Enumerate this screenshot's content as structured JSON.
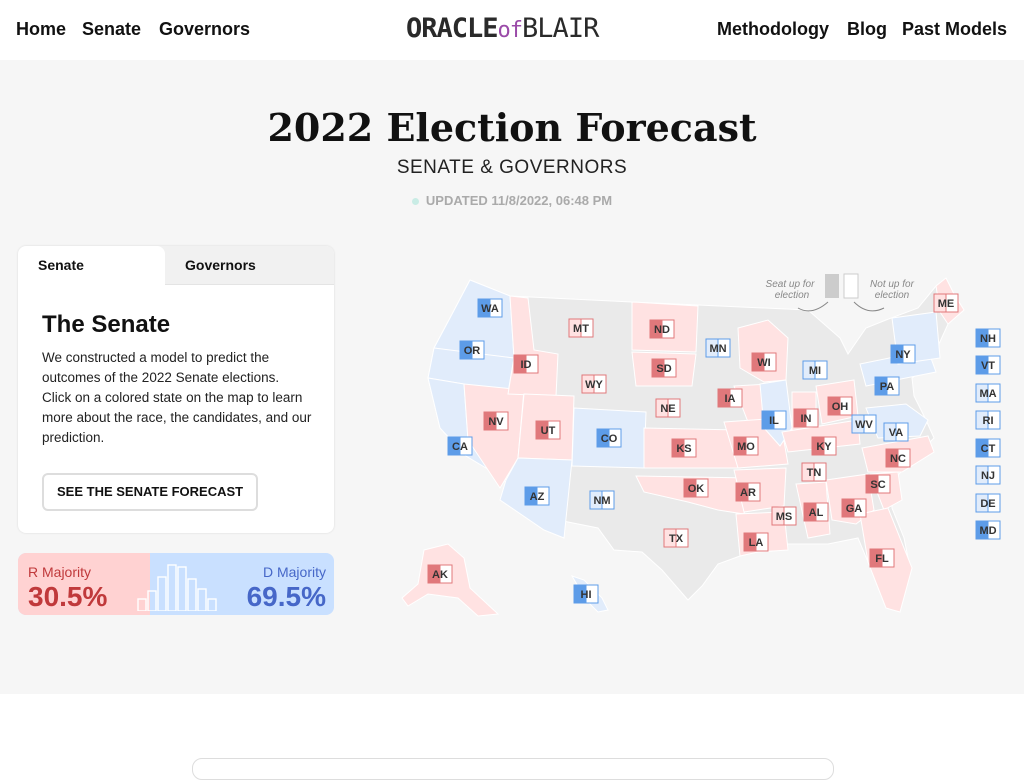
{
  "nav": {
    "left_links": [
      "Home",
      "Senate",
      "Governors"
    ],
    "right_links": [
      "Methodology",
      "Blog",
      "Past Models"
    ],
    "logo": {
      "part1": "ORACLE",
      "part2": "of",
      "part3": "BLAIR"
    }
  },
  "hero": {
    "title": "2022 Election Forecast",
    "subtitle": "SENATE & GOVERNORS",
    "updated": "UPDATED 11/8/2022, 06:48 PM"
  },
  "card": {
    "tabs": [
      "Senate",
      "Governors"
    ],
    "active_tab": "Senate",
    "heading": "The Senate",
    "description": "We constructed a model to predict the outcomes of the 2022 Senate elections. Click on a colored state on the map to learn more about the race, the candidates, and our prediction.",
    "cta_label": "SEE THE SENATE FORECAST"
  },
  "odds": {
    "r_label": "R Majority",
    "r_value": "30.5%",
    "d_label": "D Majority",
    "d_value": "69.5%",
    "r_fraction": 0.305
  },
  "map": {
    "legend": {
      "up": "Seat up for election",
      "not_up": "Not up for election"
    },
    "states": [
      {
        "abbr": "WA",
        "lean": "D",
        "senate": true
      },
      {
        "abbr": "OR",
        "lean": "D",
        "senate": true
      },
      {
        "abbr": "CA",
        "lean": "D",
        "senate": true
      },
      {
        "abbr": "NV",
        "lean": "R",
        "senate": true
      },
      {
        "abbr": "ID",
        "lean": "R",
        "senate": true
      },
      {
        "abbr": "MT",
        "lean": "R",
        "senate": false
      },
      {
        "abbr": "WY",
        "lean": "R",
        "senate": false
      },
      {
        "abbr": "UT",
        "lean": "R",
        "senate": true
      },
      {
        "abbr": "AZ",
        "lean": "D",
        "senate": true
      },
      {
        "abbr": "CO",
        "lean": "D",
        "senate": true
      },
      {
        "abbr": "NM",
        "lean": "D",
        "senate": false
      },
      {
        "abbr": "ND",
        "lean": "R",
        "senate": true
      },
      {
        "abbr": "SD",
        "lean": "R",
        "senate": true
      },
      {
        "abbr": "NE",
        "lean": "R",
        "senate": false
      },
      {
        "abbr": "KS",
        "lean": "R",
        "senate": true
      },
      {
        "abbr": "OK",
        "lean": "R",
        "senate": true
      },
      {
        "abbr": "TX",
        "lean": "R",
        "senate": false
      },
      {
        "abbr": "MN",
        "lean": "D",
        "senate": false
      },
      {
        "abbr": "IA",
        "lean": "R",
        "senate": true
      },
      {
        "abbr": "MO",
        "lean": "R",
        "senate": true
      },
      {
        "abbr": "AR",
        "lean": "R",
        "senate": true
      },
      {
        "abbr": "LA",
        "lean": "R",
        "senate": true
      },
      {
        "abbr": "WI",
        "lean": "R",
        "senate": true
      },
      {
        "abbr": "IL",
        "lean": "D",
        "senate": true
      },
      {
        "abbr": "MI",
        "lean": "D",
        "senate": false
      },
      {
        "abbr": "IN",
        "lean": "R",
        "senate": true
      },
      {
        "abbr": "OH",
        "lean": "R",
        "senate": true
      },
      {
        "abbr": "KY",
        "lean": "R",
        "senate": true
      },
      {
        "abbr": "TN",
        "lean": "R",
        "senate": false
      },
      {
        "abbr": "MS",
        "lean": "R",
        "senate": false
      },
      {
        "abbr": "AL",
        "lean": "R",
        "senate": true
      },
      {
        "abbr": "GA",
        "lean": "R",
        "senate": true
      },
      {
        "abbr": "FL",
        "lean": "R",
        "senate": true
      },
      {
        "abbr": "SC",
        "lean": "R",
        "senate": true
      },
      {
        "abbr": "NC",
        "lean": "R",
        "senate": true
      },
      {
        "abbr": "VA",
        "lean": "D",
        "senate": false
      },
      {
        "abbr": "WV",
        "lean": "D",
        "senate": false
      },
      {
        "abbr": "PA",
        "lean": "D",
        "senate": true
      },
      {
        "abbr": "NY",
        "lean": "D",
        "senate": true
      },
      {
        "abbr": "ME",
        "lean": "R",
        "senate": false
      },
      {
        "abbr": "AK",
        "lean": "R",
        "senate": true
      },
      {
        "abbr": "HI",
        "lean": "D",
        "senate": true
      },
      {
        "abbr": "NH",
        "lean": "D",
        "senate": true
      },
      {
        "abbr": "VT",
        "lean": "D",
        "senate": true
      },
      {
        "abbr": "MA",
        "lean": "D",
        "senate": false
      },
      {
        "abbr": "RI",
        "lean": "D",
        "senate": false
      },
      {
        "abbr": "CT",
        "lean": "D",
        "senate": true
      },
      {
        "abbr": "NJ",
        "lean": "D",
        "senate": false
      },
      {
        "abbr": "DE",
        "lean": "D",
        "senate": false
      },
      {
        "abbr": "MD",
        "lean": "D",
        "senate": true
      }
    ]
  },
  "colors": {
    "red": "#e0787b",
    "red_light": "#ffe2e2",
    "blue": "#5d9ce8",
    "blue_light": "#e1ecfb",
    "accent": "#9a4aa8",
    "r_text": "#c0393b",
    "d_text": "#4667c8"
  }
}
